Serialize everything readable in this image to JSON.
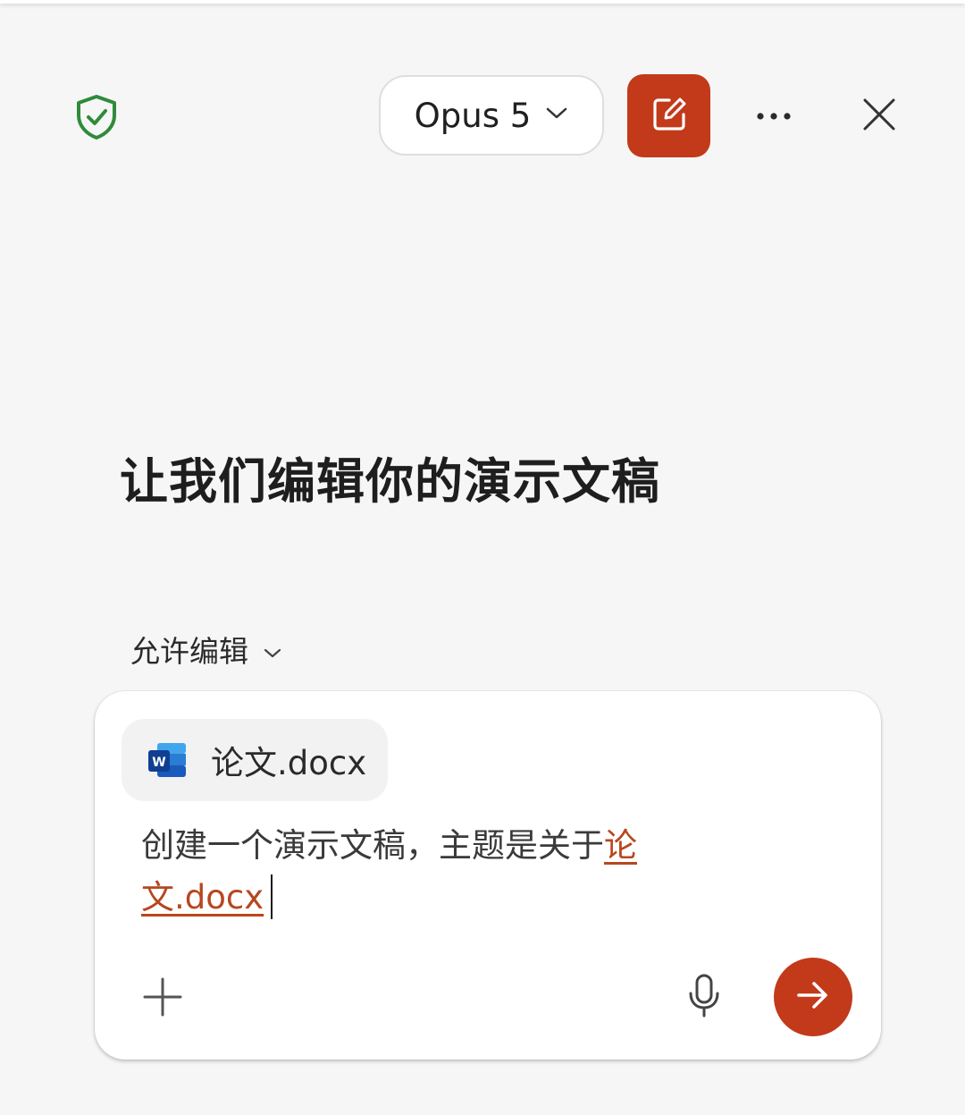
{
  "header": {
    "shield_icon": "shield-check-icon",
    "model_selector": {
      "label": "Opus 5",
      "icon": "chevron-down-icon"
    },
    "new_chat_icon": "compose-icon",
    "more_icon": "ellipsis-icon",
    "close_icon": "close-icon"
  },
  "headline": "让我们编辑你的演示文稿",
  "mode_selector": {
    "label": "允许编辑",
    "icon": "chevron-down-icon"
  },
  "composer": {
    "attachment": {
      "icon": "word-doc-icon",
      "name": "论文.docx"
    },
    "prompt_text": "创建一个演示文稿，主题是关于",
    "prompt_mention": "论文.docx",
    "add_icon": "plus-icon",
    "mic_icon": "microphone-icon",
    "send_icon": "arrow-right-icon"
  },
  "colors": {
    "accent": "#c23a1a",
    "shield": "#2e8b3a",
    "mention": "#b7471f",
    "background": "#f6f6f6"
  }
}
